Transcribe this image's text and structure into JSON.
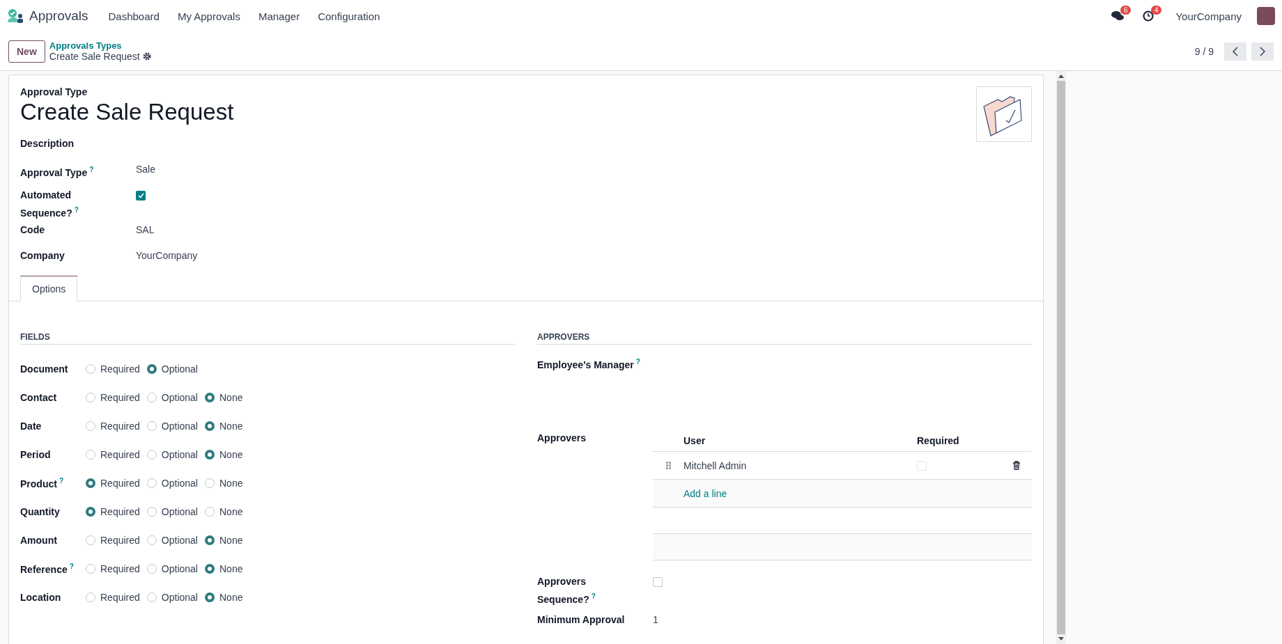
{
  "navbar": {
    "app_name": "Approvals",
    "menu": [
      "Dashboard",
      "My Approvals",
      "Manager",
      "Configuration"
    ],
    "messages_count": "6",
    "activities_count": "4",
    "company": "YourCompany"
  },
  "control_panel": {
    "new_button": "New",
    "breadcrumb": "Approvals Types",
    "current": "Create Sale Request",
    "pager": "9 / 9"
  },
  "form": {
    "overline": "Approval Type",
    "title": "Create Sale Request",
    "fields": [
      {
        "kind": "text",
        "label": "Description"
      },
      {
        "kind": "text",
        "label": "Approval Type",
        "help": "?",
        "value": "Sale"
      },
      {
        "kind": "checkbox",
        "label": "Automated Sequence?",
        "help": "?",
        "checked": true
      },
      {
        "kind": "text",
        "label": "Code",
        "value": "SAL"
      },
      {
        "kind": "text",
        "label": "Company",
        "value": "YourCompany"
      }
    ],
    "tabs": [
      {
        "label": "Options",
        "selected": true
      }
    ],
    "fields_section": {
      "title": "FIELDS",
      "rows": [
        {
          "label": "Document",
          "options": [
            {
              "label": "Required",
              "selected": false
            },
            {
              "label": "Optional",
              "selected": true
            }
          ]
        },
        {
          "label": "Contact",
          "options": [
            {
              "label": "Required",
              "selected": false
            },
            {
              "label": "Optional",
              "selected": false
            },
            {
              "label": "None",
              "selected": true
            }
          ]
        },
        {
          "label": "Date",
          "options": [
            {
              "label": "Required",
              "selected": false
            },
            {
              "label": "Optional",
              "selected": false
            },
            {
              "label": "None",
              "selected": true
            }
          ]
        },
        {
          "label": "Period",
          "options": [
            {
              "label": "Required",
              "selected": false
            },
            {
              "label": "Optional",
              "selected": false
            },
            {
              "label": "None",
              "selected": true
            }
          ]
        },
        {
          "label": "Product",
          "help": "?",
          "options": [
            {
              "label": "Required",
              "selected": true
            },
            {
              "label": "Optional",
              "selected": false
            },
            {
              "label": "None",
              "selected": false
            }
          ]
        },
        {
          "label": "Quantity",
          "options": [
            {
              "label": "Required",
              "selected": true
            },
            {
              "label": "Optional",
              "selected": false
            },
            {
              "label": "None",
              "selected": false
            }
          ]
        },
        {
          "label": "Amount",
          "options": [
            {
              "label": "Required",
              "selected": false
            },
            {
              "label": "Optional",
              "selected": false
            },
            {
              "label": "None",
              "selected": true
            }
          ]
        },
        {
          "label": "Reference",
          "help": "?",
          "options": [
            {
              "label": "Required",
              "selected": false
            },
            {
              "label": "Optional",
              "selected": false
            },
            {
              "label": "None",
              "selected": true
            }
          ]
        },
        {
          "label": "Location",
          "options": [
            {
              "label": "Required",
              "selected": false
            },
            {
              "label": "Optional",
              "selected": false
            },
            {
              "label": "None",
              "selected": true
            }
          ]
        }
      ]
    },
    "approvers_section": {
      "title": "APPROVERS",
      "employee_manager": {
        "label": "Employee's Manager",
        "help": "?"
      },
      "approvers": {
        "label": "Approvers",
        "columns": [
          "User",
          "Required"
        ],
        "rows": [
          {
            "user": "Mitchell Admin",
            "required": false
          }
        ],
        "add_line": "Add a line"
      },
      "sequence": {
        "label": "Approvers Sequence?",
        "help": "?",
        "checked": false
      },
      "minimum": {
        "label": "Minimum Approval",
        "value": "1"
      }
    }
  }
}
